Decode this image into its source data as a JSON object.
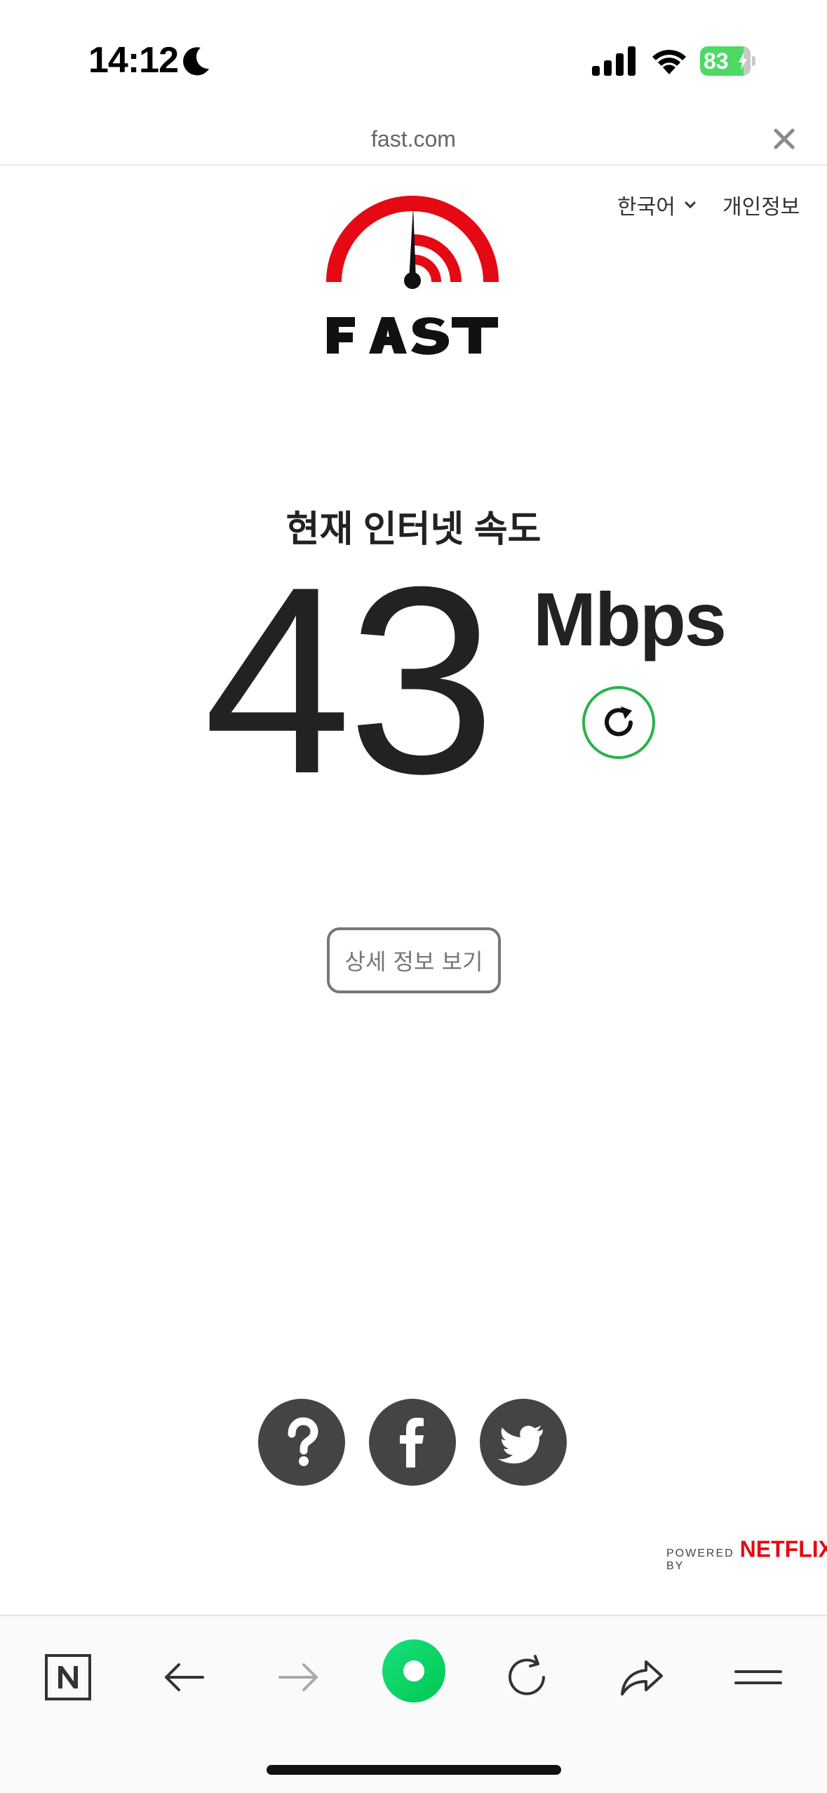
{
  "status_bar": {
    "time": "14:12",
    "battery_level": "83"
  },
  "browser": {
    "url": "fast.com"
  },
  "header": {
    "language": "한국어",
    "privacy": "개인정보"
  },
  "speed": {
    "label": "현재 인터넷 속도",
    "value": "43",
    "unit": "Mbps"
  },
  "details_button": "상세 정보 보기",
  "footer": {
    "powered_by": "POWERED BY",
    "brand": "NETFLIX"
  },
  "colors": {
    "accent_green": "#2bb24c",
    "logo_red": "#e50914",
    "social_bg": "#444444",
    "toolbar_green": "#00c853"
  },
  "icons": [
    "moon-icon",
    "signal-icon",
    "wifi-icon",
    "battery-icon",
    "close-icon",
    "chevron-down-icon",
    "refresh-icon",
    "help-icon",
    "facebook-icon",
    "twitter-icon",
    "naver-icon",
    "back-arrow-icon",
    "forward-arrow-icon",
    "home-dot-icon",
    "reload-icon",
    "share-icon",
    "menu-icon"
  ]
}
